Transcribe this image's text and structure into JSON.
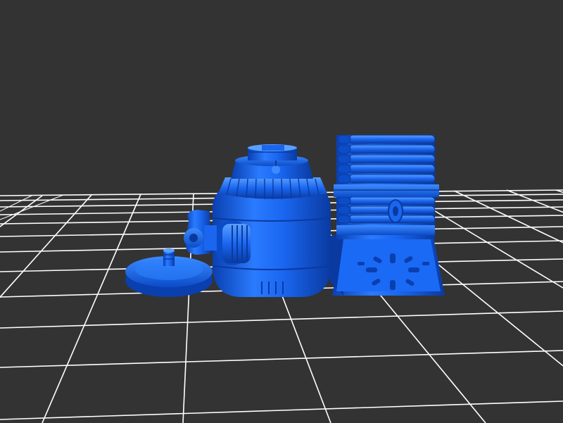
{
  "viewport": {
    "background_color": "#333333",
    "grid_color": "#ffffff",
    "model_color": "#1a6eff"
  },
  "objects": [
    {
      "name": "flat-disc-cap"
    },
    {
      "name": "round-tank-body"
    },
    {
      "name": "ribbed-cylinder-on-base"
    }
  ]
}
